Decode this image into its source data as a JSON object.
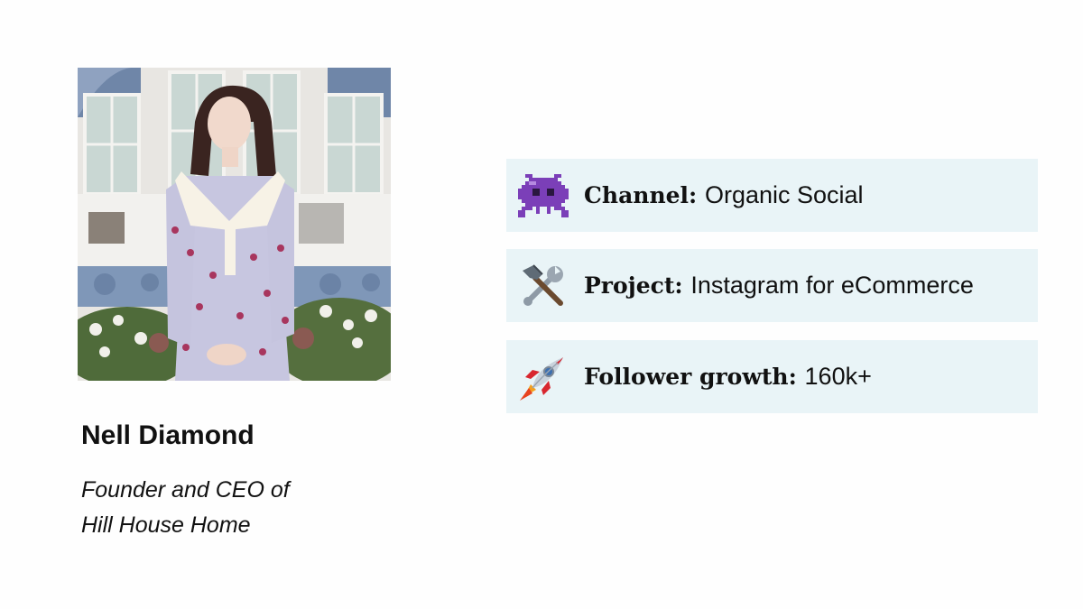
{
  "profile": {
    "name": "Nell Diamond",
    "role_line1": "Founder and CEO of",
    "role_line2": "Hill House Home"
  },
  "stats": [
    {
      "icon": "alien-monster-icon",
      "label": "Channel:",
      "value": "Organic Social"
    },
    {
      "icon": "hammer-and-wrench-icon",
      "label": "Project:",
      "value": "Instagram for eCommerce"
    },
    {
      "icon": "rocket-icon",
      "label": "Follower growth:",
      "value": "160k+"
    }
  ],
  "colors": {
    "card_background": "#e9f4f7",
    "text": "#111111",
    "page_background": "#fefefe"
  }
}
